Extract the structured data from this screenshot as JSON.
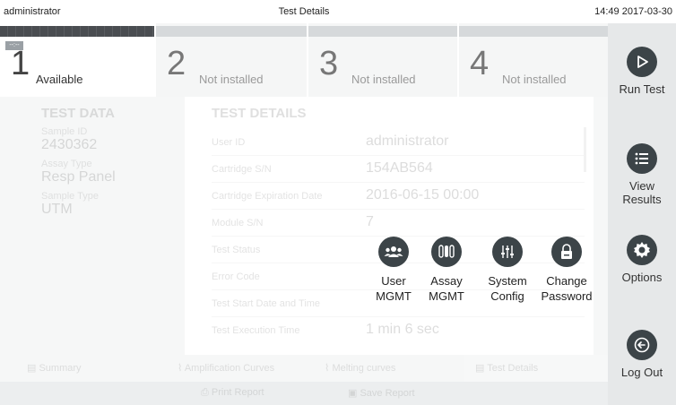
{
  "topbar": {
    "user": "administrator",
    "title": "Test Details",
    "datetime": "14:49 2017-03-30"
  },
  "modules": [
    {
      "number": "1",
      "status": "Available",
      "tag": "--:--"
    },
    {
      "number": "2",
      "status": "Not installed"
    },
    {
      "number": "3",
      "status": "Not installed"
    },
    {
      "number": "4",
      "status": "Not installed"
    }
  ],
  "sidebar": {
    "run_test": "Run Test",
    "view_results_line1": "View",
    "view_results_line2": "Results",
    "options": "Options",
    "log_out": "Log Out"
  },
  "test_data": {
    "heading": "TEST DATA",
    "sample_id_label": "Sample ID",
    "sample_id": "2430362",
    "assay_type_label": "Assay Type",
    "assay_type": "Resp Panel",
    "sample_type_label": "Sample Type",
    "sample_type": "UTM"
  },
  "test_details": {
    "heading": "TEST DETAILS",
    "rows": [
      {
        "label": "User ID",
        "value": "administrator"
      },
      {
        "label": "Cartridge S/N",
        "value": "154AB564"
      },
      {
        "label": "Cartridge Expiration Date",
        "value": "2016-06-15 00:00"
      },
      {
        "label": "Module S/N",
        "value": "7"
      },
      {
        "label": "Test Status",
        "value": ""
      },
      {
        "label": "Error Code",
        "value": ""
      },
      {
        "label": "Test Start Date and Time",
        "value": ""
      },
      {
        "label": "Test Execution Time",
        "value": "1 min 6 sec"
      }
    ]
  },
  "popup": {
    "user_mgmt_line1": "User",
    "user_mgmt_line2": "MGMT",
    "assay_mgmt_line1": "Assay",
    "assay_mgmt_line2": "MGMT",
    "system_config_line1": "System",
    "system_config_line2": "Config",
    "change_password_line1": "Change",
    "change_password_line2": "Password"
  },
  "bottom_tabs": [
    "Summary",
    "Amplification Curves",
    "Melting curves",
    "Test Details"
  ],
  "actions": {
    "print": "Print Report",
    "save": "Save Report"
  },
  "colors": {
    "icon_bg": "#3c4448",
    "sidebar_bg": "#e6e8e9",
    "active_strip": "#4a4d51"
  }
}
